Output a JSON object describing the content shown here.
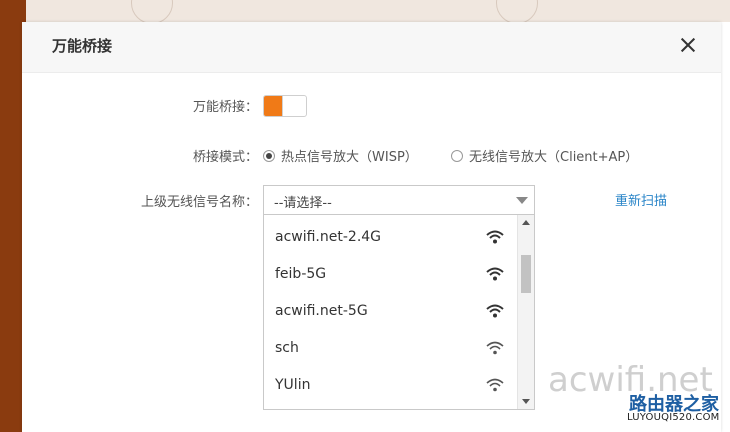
{
  "dialog": {
    "title": "万能桥接"
  },
  "bridge": {
    "label": "万能桥接：",
    "enabled": true,
    "accent_color": "#f07a17"
  },
  "mode": {
    "label": "桥接模式：",
    "options": [
      {
        "label": "热点信号放大（WISP）",
        "selected": true
      },
      {
        "label": "无线信号放大（Client+AP）",
        "selected": false
      }
    ]
  },
  "upstream": {
    "label": "上级无线信号名称：",
    "select_value": "--请选择--",
    "rescan_label": "重新扫描",
    "networks": [
      {
        "ssid": "acwifi.net-2.4G",
        "icon": "wifi-signal-icon"
      },
      {
        "ssid": "feib-5G",
        "icon": "wifi-signal-icon"
      },
      {
        "ssid": "acwifi.net-5G",
        "icon": "wifi-signal-icon"
      },
      {
        "ssid": "sch",
        "icon": "wifi-signal-icon"
      },
      {
        "ssid": "YUlin",
        "icon": "wifi-signal-icon"
      }
    ]
  },
  "watermark": {
    "main": "acwifi.net",
    "brand": "路由器之家",
    "url": "LUYOUQI520.COM"
  }
}
